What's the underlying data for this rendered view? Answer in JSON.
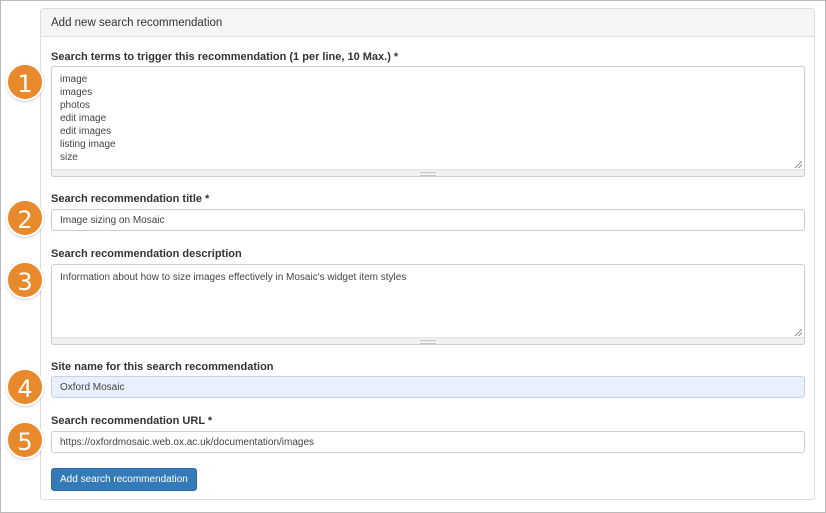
{
  "panel": {
    "heading": "Add new search recommendation"
  },
  "form": {
    "terms": {
      "label": "Search terms to trigger this recommendation (1 per line, 10 Max.) *",
      "lines": [
        "image",
        "images",
        "photos",
        "edit image",
        "edit images",
        "listing image",
        "size"
      ]
    },
    "title": {
      "label": "Search recommendation title *",
      "value": "Image sizing on Mosaic"
    },
    "description": {
      "label": "Search recommendation description",
      "value": "Information about how to size images effectively in Mosaic's widget item styles"
    },
    "site_name": {
      "label": "Site name for this search recommendation",
      "value": "Oxford Mosaic"
    },
    "url": {
      "label": "Search recommendation URL *",
      "value": "https://oxfordmosaic.web.ox.ac.uk/documentation/images"
    },
    "submit_label": "Add search recommendation"
  },
  "step_badges": [
    "1",
    "2",
    "3",
    "4",
    "5"
  ],
  "colors": {
    "badge": "#e8892c",
    "primary_button": "#337ab7",
    "autofill_background": "#e8f0fe"
  }
}
